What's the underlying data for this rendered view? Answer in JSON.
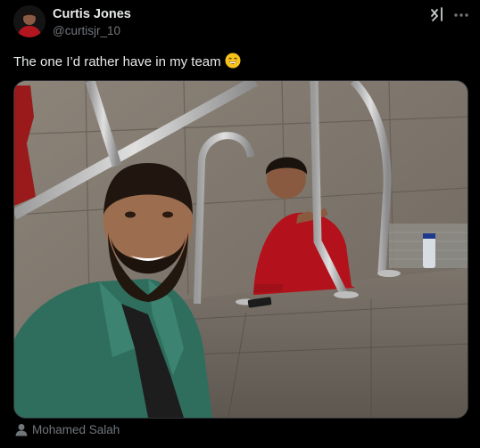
{
  "tweet": {
    "author": {
      "display_name": "Curtis Jones",
      "handle": "@curtisjr_10"
    },
    "text": "The one I’d rather have in my team",
    "emoji": "grinning-face-with-smiling-eyes",
    "tagged_user": "Mohamed Salah"
  },
  "icons": {
    "grok": "grok-icon",
    "more": "more-icon",
    "tag": "person-icon"
  },
  "colors": {
    "background": "#000000",
    "primary_text": "#e7e9ea",
    "secondary_text": "#71767b",
    "border": "#2f3336"
  }
}
